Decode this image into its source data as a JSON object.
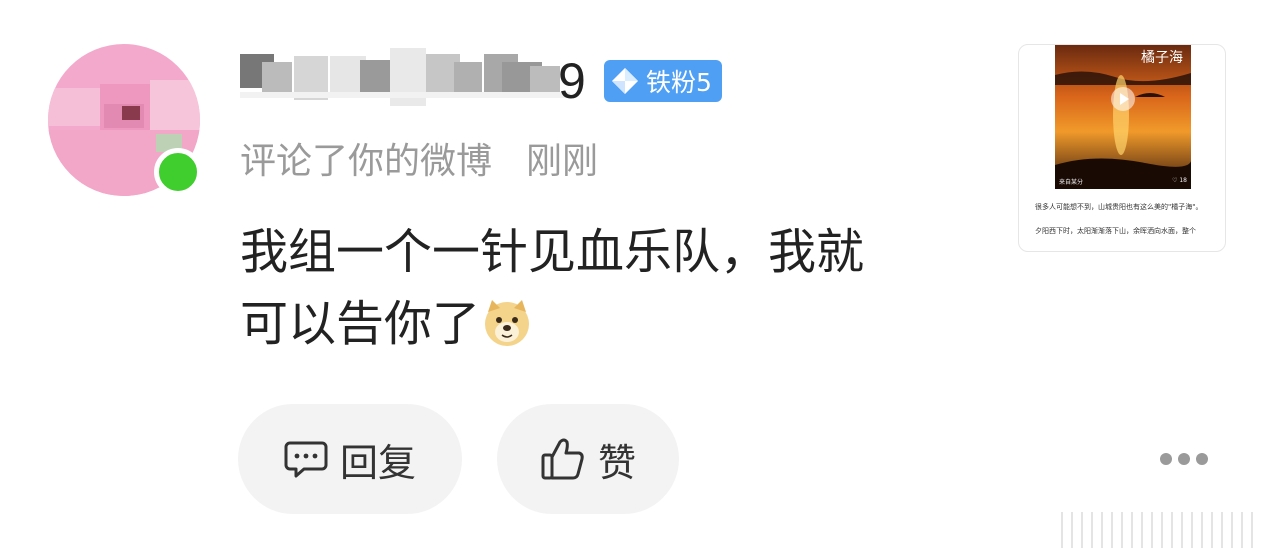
{
  "user": {
    "name_visible_suffix": "9",
    "name_obscured": "永恒",
    "fan_badge": "铁粉5"
  },
  "meta": {
    "action": "评论了你的微博",
    "time": "刚刚"
  },
  "comment": {
    "line1": "我组一个一针见血乐队，我就",
    "line2": "可以告你了"
  },
  "actions": {
    "reply": "回复",
    "like": "赞"
  },
  "thumbnail": {
    "overlay_title": "橘子海",
    "footer_left": "来自某分",
    "footer_right": "♡ 18",
    "caption_1": "很多人可能想不到，山城贵阳也有这么美的\"橘子海\"。",
    "caption_2": "夕阳西下时，太阳渐渐落下山，余晖洒向水面，整个"
  },
  "colors": {
    "badge": "#4f9ff5",
    "online": "#3fce2e",
    "avatar": "#f3a9cc"
  },
  "icons": [
    "comment-icon",
    "thumbs-up-icon",
    "more-icon",
    "diamond-icon",
    "doge-emoji-icon",
    "play-icon"
  ]
}
